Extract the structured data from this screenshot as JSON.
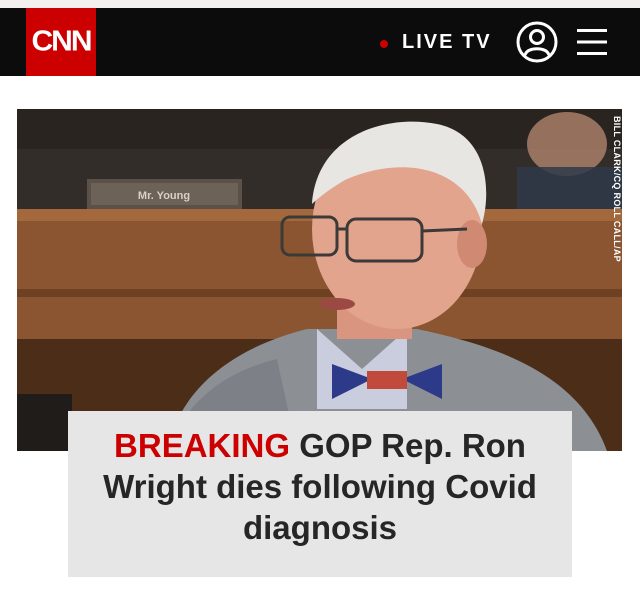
{
  "header": {
    "logo_text": "CNN",
    "live_label": "LIVE TV",
    "account_icon": "account-icon",
    "menu_icon": "hamburger-menu-icon"
  },
  "hero": {
    "photo_credit": "BILL CLARK/CQ ROLL CALL/AP",
    "nameplate_text": "Mr. Young"
  },
  "headline": {
    "tag": "BREAKING",
    "text": "GOP Rep. Ron Wright dies following Covid diagnosis"
  },
  "colors": {
    "brand_red": "#cc0000",
    "navbar_bg": "#0c0c0c",
    "caption_bg": "#e6e6e6",
    "headline_text": "#262626"
  }
}
